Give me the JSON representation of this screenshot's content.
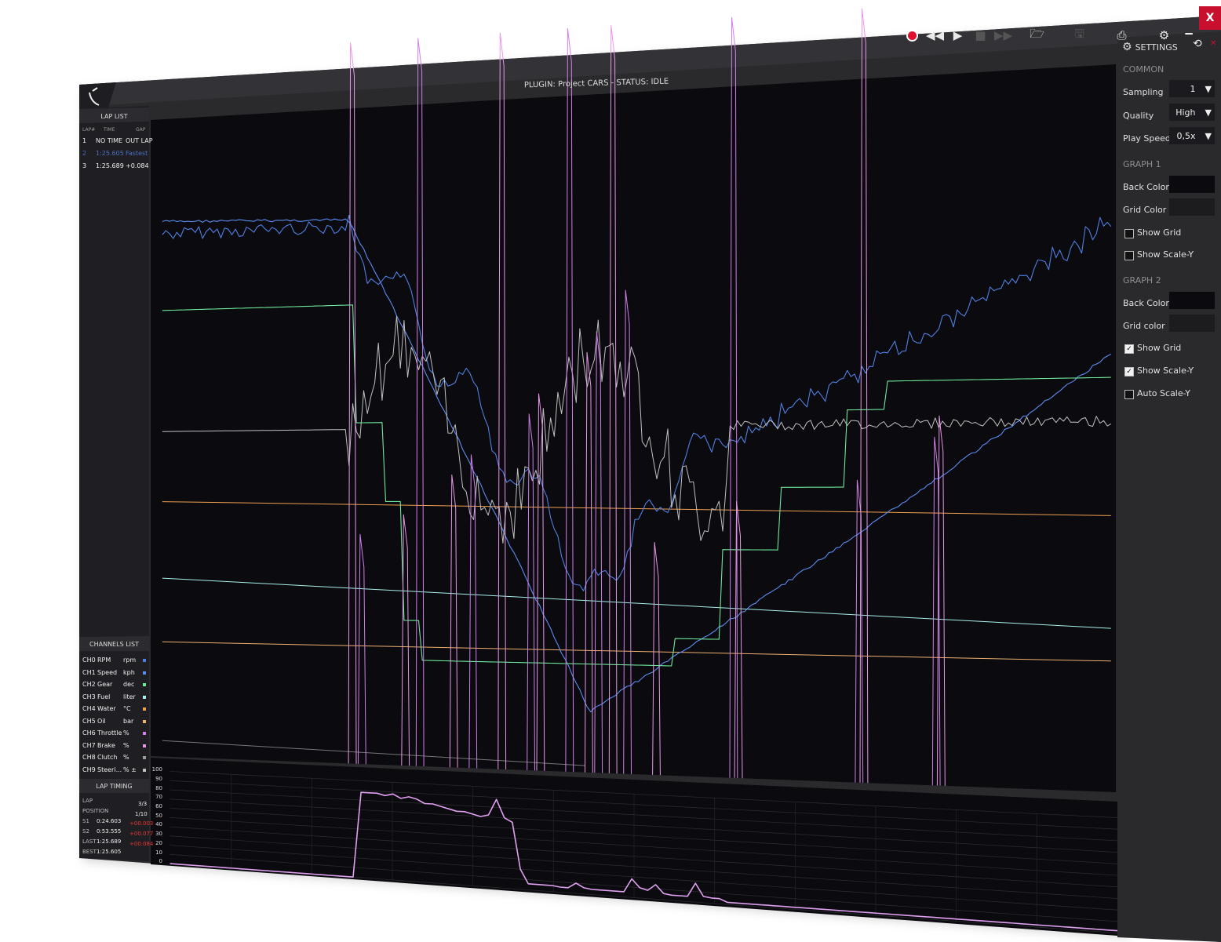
{
  "toolbar": {
    "buttons": [
      {
        "name": "record-button",
        "icon": "record-icon"
      },
      {
        "name": "rewind-button",
        "icon": "rewind-icon"
      },
      {
        "name": "play-button",
        "icon": "play-icon"
      },
      {
        "name": "stop-button",
        "icon": "stop-icon"
      },
      {
        "name": "fast-forward-button",
        "icon": "fast-forward-icon"
      },
      {
        "name": "open-button",
        "icon": "folder-open-icon"
      },
      {
        "name": "save-button",
        "icon": "save-icon"
      },
      {
        "name": "print-button",
        "icon": "printer-icon"
      },
      {
        "name": "settings-button",
        "icon": "gear-icon"
      }
    ],
    "close_label": "X"
  },
  "status": "PLUGIN: Project CARS - STATUS: IDLE",
  "lap_list": {
    "title": "LAP LIST",
    "headers": [
      "LAP#",
      "TIME",
      "GAP"
    ],
    "rows": [
      {
        "lap": "1",
        "time": "NO TIME",
        "gap": "OUT LAP",
        "highlight": false
      },
      {
        "lap": "2",
        "time": "1:25.605",
        "gap": "Fastest",
        "highlight": true
      },
      {
        "lap": "3",
        "time": "1:25.689",
        "gap": "+0.084",
        "highlight": false
      }
    ]
  },
  "channels_list": {
    "title": "CHANNELS LIST",
    "rows": [
      {
        "ch": "CH0",
        "name": "RPM",
        "unit": "rpm",
        "color": "#4f7fe0"
      },
      {
        "ch": "CH1",
        "name": "Speed",
        "unit": "kph",
        "color": "#5b8df0"
      },
      {
        "ch": "CH2",
        "name": "Gear",
        "unit": "dec",
        "color": "#6ee89a"
      },
      {
        "ch": "CH3",
        "name": "Fuel",
        "unit": "liter",
        "color": "#a8f0e8"
      },
      {
        "ch": "CH4",
        "name": "Water",
        "unit": "°C",
        "color": "#f0a050"
      },
      {
        "ch": "CH5",
        "name": "Oil",
        "unit": "bar",
        "color": "#f0b070"
      },
      {
        "ch": "CH6",
        "name": "Throttle",
        "unit": "%",
        "color": "#d080e8"
      },
      {
        "ch": "CH7",
        "name": "Brake",
        "unit": "%",
        "color": "#e898e8"
      },
      {
        "ch": "CH8",
        "name": "Clutch",
        "unit": "%",
        "color": "#9a9a9a"
      },
      {
        "ch": "CH9",
        "name": "Steeri...",
        "unit": "% ±",
        "color": "#c0c0c0"
      }
    ]
  },
  "lap_timing": {
    "title": "LAP TIMING",
    "lap_label": "LAP",
    "lap_value": "3/3",
    "position_label": "POSITION",
    "position_value": "1/10",
    "rows": [
      {
        "label": "S1",
        "time": "0:24.603",
        "delta": "+00.003"
      },
      {
        "label": "S2",
        "time": "0:53.555",
        "delta": "+00.077"
      },
      {
        "label": "LAST",
        "time": "1:25.689",
        "delta": "+00.084"
      },
      {
        "label": "BEST",
        "time": "1:25.605",
        "delta": ""
      }
    ]
  },
  "settings": {
    "title": "SETTINGS",
    "common_label": "COMMON",
    "sampling_label": "Sampling",
    "sampling_value": "1",
    "quality_label": "Quality",
    "quality_value": "High",
    "playspeed_label": "Play Speed",
    "playspeed_value": "0,5x",
    "graph1_label": "GRAPH 1",
    "g1_back_label": "Back Color",
    "g1_back_color": "#0b0a0f",
    "g1_grid_label": "Grid Color",
    "g1_grid_color": "#1c1c1f",
    "g1_showgrid_label": "Show Grid",
    "g1_showgrid": false,
    "g1_scaley_label": "Show Scale-Y",
    "g1_scaley": false,
    "graph2_label": "GRAPH 2",
    "g2_back_label": "Back Color",
    "g2_back_color": "#0b0a0f",
    "g2_grid_label": "Grid color",
    "g2_grid_color": "#1c1c1f",
    "g2_showgrid_label": "Show Grid",
    "g2_showgrid": true,
    "g2_scaley_label": "Show Scale-Y",
    "g2_scaley": true,
    "g2_autoscale_label": "Auto  Scale-Y",
    "g2_autoscale": false
  },
  "chart_data": {
    "type": "line",
    "y_ticks": [
      "100",
      "90",
      "80",
      "70",
      "60",
      "50",
      "40",
      "30",
      "20",
      "10",
      "0"
    ],
    "ylim": [
      0,
      100
    ],
    "series": [
      {
        "name": "Throttle",
        "color": "#e0a0f0",
        "values": [
          0,
          0,
          0,
          0,
          0,
          0,
          0,
          0,
          0,
          0,
          0,
          0,
          0,
          0,
          0,
          0,
          0,
          0,
          0,
          0,
          0,
          0,
          0,
          0,
          88,
          88,
          88,
          86,
          88,
          84,
          86,
          84,
          80,
          80,
          78,
          76,
          74,
          74,
          72,
          70,
          72,
          88,
          70,
          66,
          20,
          6,
          6,
          6,
          6,
          5,
          5,
          10,
          6,
          5,
          5,
          5,
          5,
          5,
          18,
          10,
          8,
          14,
          6,
          5,
          5,
          5,
          18,
          6,
          5,
          5,
          2,
          2,
          2,
          2,
          2,
          2,
          2,
          2,
          2,
          2,
          2,
          2,
          2,
          2,
          2,
          2,
          2,
          2,
          2,
          2,
          2,
          2,
          2,
          2,
          2,
          2,
          2,
          2,
          2,
          2,
          2,
          2,
          2,
          2,
          2,
          2,
          2,
          2,
          2,
          2,
          2,
          2,
          2,
          2,
          2,
          2,
          2,
          2,
          2,
          2
        ]
      }
    ]
  }
}
